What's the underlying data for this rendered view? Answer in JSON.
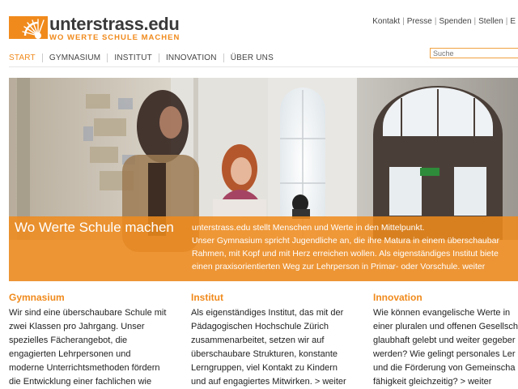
{
  "header": {
    "logo_title": "unterstrass.edu",
    "logo_tagline": "WO WERTE SCHULE MACHEN",
    "top_links": [
      "Kontakt",
      "Presse",
      "Spenden",
      "Stellen",
      "E"
    ],
    "search_placeholder": "Suche"
  },
  "nav": {
    "items": [
      "START",
      "GYMNASIUM",
      "INSTITUT",
      "INNOVATION",
      "ÜBER UNS"
    ],
    "active": "START"
  },
  "hero": {
    "title": "Wo Werte Schule machen",
    "lines": [
      "unterstrass.edu stellt Menschen und Werte in den Mittelpunkt.",
      "Unser Gymnasium spricht Jugendliche an, die ihre Matura in einem überschaubar",
      "Rahmen, mit Kopf und mit Herz erreichen wollen. Als eigenständiges Institut biete",
      "einen praxisorientierten Weg zur Lehrperson in Primar- oder Vorschule. weiter"
    ]
  },
  "columns": [
    {
      "title": "Gymnasium",
      "lines": [
        "Wir sind eine überschaubare Schule mit",
        "zwei Klassen pro Jahrgang. Unser",
        "spezielles Fächerangebot, die",
        "engagierten Lehrpersonen und",
        "moderne Unterrichtsmethoden fördern",
        "die Entwicklung einer fachlichen wie"
      ]
    },
    {
      "title": "Institut",
      "lines": [
        "Als eigenständiges Institut, das mit der",
        "Pädagogischen Hochschule Zürich",
        "zusammenarbeitet, setzen wir auf",
        "überschaubare Strukturen, konstante",
        "Lerngruppen, viel Kontakt zu Kindern",
        "und auf engagiertes Mitwirken. > weiter"
      ]
    },
    {
      "title": "Innovation",
      "lines": [
        "Wie können evangelische Werte in",
        "einer pluralen und offenen Gesellsch",
        "glaubhaft gelebt und weiter gegeber",
        "werden? Wie gelingt personales Ler",
        "und die Förderung von Gemeinscha",
        "fähigkeit gleichzeitig? > weiter"
      ]
    }
  ],
  "colors": {
    "accent": "#f08a1c",
    "text": "#222222",
    "logo_dark": "#3a3a3a"
  },
  "icons": {
    "logo_mark": "sunburst-logo-icon"
  }
}
